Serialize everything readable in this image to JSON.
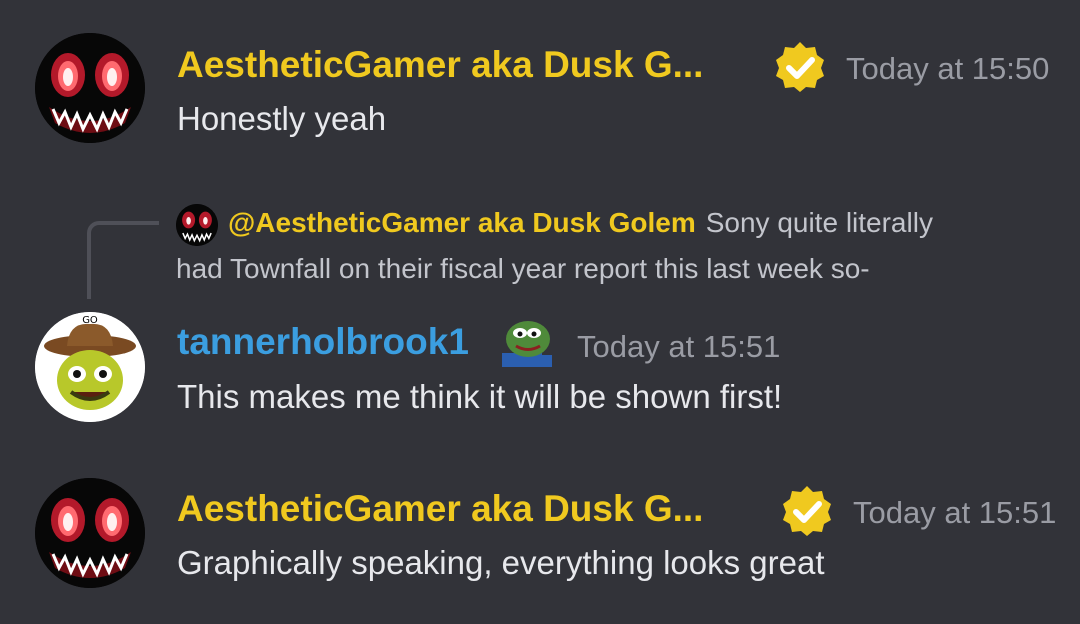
{
  "messages": [
    {
      "author": "AestheticGamer aka Dusk G...",
      "timestamp": "Today at 15:50",
      "text": "Honestly yeah"
    },
    {
      "reply_to": {
        "mention": "@AestheticGamer aka Dusk Golem",
        "text_line1": "Sony quite literally",
        "text_line2": "had Townfall on their fiscal year report this last week so-"
      },
      "author": "tannerholbrook1",
      "timestamp": "Today at 15:51",
      "text": "This makes me think it will be shown first!",
      "avatar_label": "GO"
    },
    {
      "author": "AestheticGamer aka Dusk G...",
      "timestamp": "Today at 15:51",
      "text": "Graphically speaking, everything looks great"
    }
  ],
  "colors": {
    "background": "#323339",
    "gold_name": "#f0c91f",
    "blue_name": "#3b9ee0",
    "timestamp": "#9a9ca4",
    "text": "#e7e8ec"
  },
  "icons": [
    "verified-badge-icon",
    "pepe-emoji-icon"
  ]
}
